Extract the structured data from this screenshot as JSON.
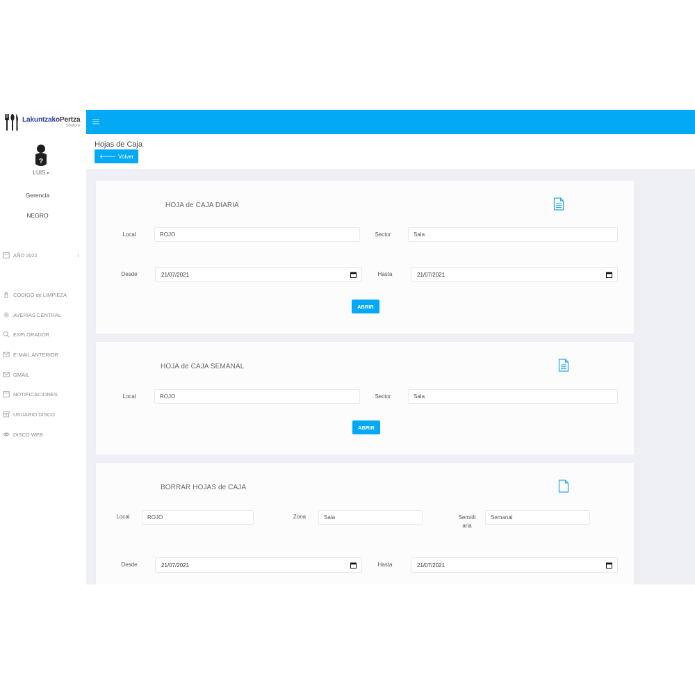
{
  "brand": {
    "name_part1": "Lakuntzako",
    "name_part2": "Pertza",
    "subtitle": "Solutions"
  },
  "user": {
    "name": "LUIS",
    "caret": "▾",
    "role": "Gerencia",
    "group": "NEGRO"
  },
  "sidebar": {
    "year_item": {
      "label": "AÑO 2021",
      "chevron": "›",
      "icon": "calendar-icon"
    },
    "items": [
      {
        "label": "CÓDIGO de LIMPIEZA",
        "icon": "spray-bottle-icon"
      },
      {
        "label": "AVERÍAS CENTRAL",
        "icon": "gear-icon"
      },
      {
        "label": "EXPLORADOR",
        "icon": "search-icon"
      },
      {
        "label": "E-MAIL ANTERIOR",
        "icon": "mail-icon"
      },
      {
        "label": "GMAIL",
        "icon": "mail-icon"
      },
      {
        "label": "NOTIFICACIONES",
        "icon": "calendar-icon"
      },
      {
        "label": "USUARIO DISCO",
        "icon": "archive-icon"
      },
      {
        "label": "DISCO WEB",
        "icon": "eye-icon"
      }
    ]
  },
  "header": {
    "title": "Hojas de Caja",
    "back_label": "Volver",
    "back_icon": "arrow-left-icon"
  },
  "cards": {
    "diaria": {
      "title": "HOJA de CAJA DIARIA",
      "local_label": "Local",
      "local_value": "ROJO",
      "sector_label": "Sector",
      "sector_value": "Sala",
      "desde_label": "Desde",
      "desde_value": "21/07/2021",
      "hasta_label": "Hasta",
      "hasta_value": "21/07/2021",
      "button": "ABRIR"
    },
    "semanal": {
      "title": "HOJA de CAJA SEMANAL",
      "local_label": "Local",
      "local_value": "ROJO",
      "sector_label": "Sector",
      "sector_value": "Sala",
      "button": "ABRIR"
    },
    "borrar": {
      "title": "BORRAR HOJAS de CAJA",
      "local_label": "Local",
      "local_value": "ROJO",
      "zona_label": "Zona",
      "zona_value": "Sala",
      "semdiaria_label_1": "Sem/di",
      "semdiaria_label_2": "aria",
      "semdiaria_value": "Semanal",
      "desde_label": "Desde",
      "desde_value": "21/07/2021",
      "hasta_label": "Hasta",
      "hasta_value": "21/07/2021"
    }
  },
  "colors": {
    "accent": "#03a9f4",
    "brand_blue": "#2d3ba8",
    "content_bg": "#eef0f5"
  }
}
